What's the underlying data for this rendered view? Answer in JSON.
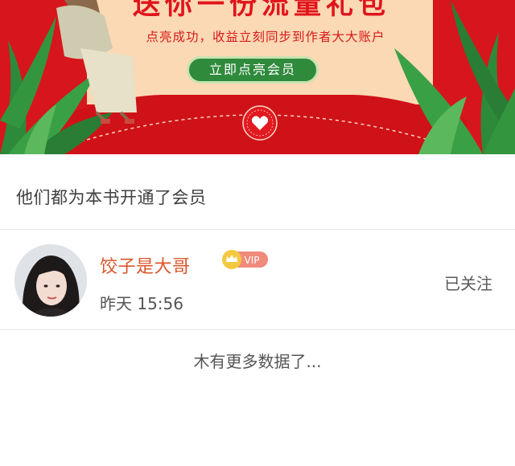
{
  "banner": {
    "heading": "送你一份流量礼包",
    "subtitle": "点亮成功，收益立刻同步到作者大大账户",
    "cta_label": "立即点亮会员",
    "colors": {
      "background": "#d6161c",
      "paper": "#fbd9b4",
      "button": "#2f8a3c"
    }
  },
  "members_section": {
    "title": "他们都为本书开通了会员"
  },
  "members": [
    {
      "name": "饺子是大哥",
      "badge": "VIP",
      "time": "昨天 15:56",
      "follow_status": "已关注",
      "name_color": "#d9562a"
    }
  ],
  "footer": {
    "no_more_text": "木有更多数据了..."
  }
}
